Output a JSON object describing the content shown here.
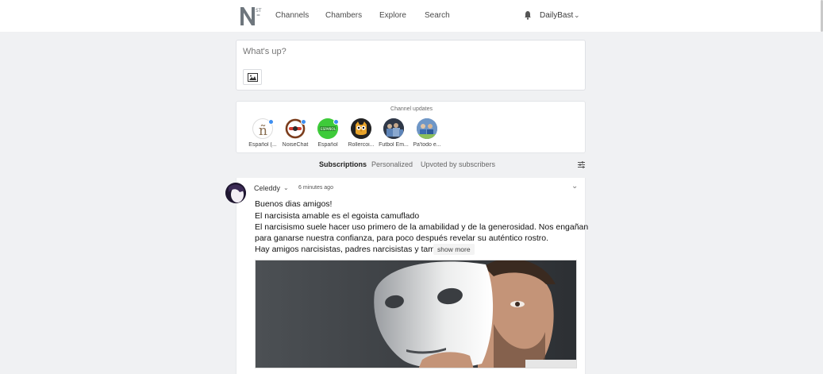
{
  "nav": {
    "links": [
      "Channels",
      "Chambers",
      "Explore",
      "Search"
    ],
    "user": "DailyBast",
    "colors": {
      "background": "#ffffff",
      "text": "#4b4b4b"
    }
  },
  "composer": {
    "placeholder": "What's up?"
  },
  "channel_updates": {
    "title": "Channel updates",
    "channels": [
      {
        "label": "Español (...",
        "icon": "ñ-logo",
        "unread": true
      },
      {
        "label": "NoiseChat",
        "icon": "noisechat-logo",
        "unread": true
      },
      {
        "label": "Español",
        "icon": "espanol-green-logo",
        "unread": true
      },
      {
        "label": "Rollercoi...",
        "icon": "owl-logo",
        "unread": false
      },
      {
        "label": "Futbol Em...",
        "icon": "football-team-photo",
        "unread": false
      },
      {
        "label": "Pa'todo e...",
        "icon": "group-photo",
        "unread": false
      }
    ]
  },
  "feed_tabs": [
    "Subscriptions",
    "Personalized",
    "Upvoted by subscribers"
  ],
  "active_tab": "Subscriptions",
  "post": {
    "author": "Celeddy",
    "time": "6 minutes ago",
    "lines": [
      "Buenos dias amigos!",
      "El narcisista amable es el egoista camuflado",
      "El narcisismo suele hacer uso primero de la amabilidad y de la generosidad. Nos engañan",
      "para ganarse nuestra confianza, para poco después revelar su auténtico rostro.",
      "Hay amigos narcisistas, padres narcisistas y tam..."
    ],
    "show_more": "show more",
    "image": "man-holding-white-mask-photo"
  },
  "accent_color": "#3d8ef0"
}
